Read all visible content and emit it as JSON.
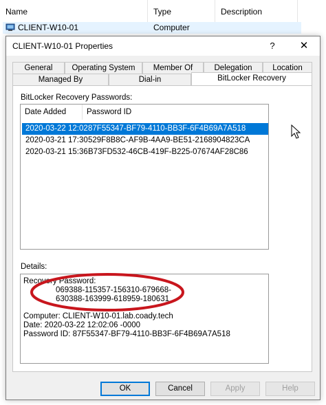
{
  "background_list": {
    "columns": [
      "Name",
      "Type",
      "Description"
    ],
    "row": {
      "name": "CLIENT-W10-01",
      "type": "Computer"
    }
  },
  "dialog": {
    "title": "CLIENT-W10-01 Properties",
    "help": "?",
    "close": "✕",
    "tabs_row1": [
      "General",
      "Operating System",
      "Member Of",
      "Delegation",
      "Location"
    ],
    "tabs_row2": [
      "Managed By",
      "Dial-in",
      "BitLocker Recovery"
    ],
    "active_tab": "BitLocker Recovery",
    "passwords_label": "BitLocker Recovery Passwords:",
    "list_columns": [
      "Date Added",
      "Password ID"
    ],
    "rows": [
      {
        "date": "2020-03-22 12:02",
        "id": "87F55347-BF79-4110-BB3F-6F4B69A7A518"
      },
      {
        "date": "2020-03-21 17:30",
        "id": "529F8B8C-AF9B-4AA9-BE51-2168904823CA"
      },
      {
        "date": "2020-03-21 15:36",
        "id": "B73FD532-46CB-419F-B225-07674AF28C86"
      }
    ],
    "details_label": "Details:",
    "details": {
      "recovery_label": "Recovery Password:",
      "recovery_line1": "069388-115357-156310-679668-",
      "recovery_line2": "630388-163999-618959-180631",
      "computer": "Computer: CLIENT-W10-01.lab.coady.tech",
      "date": "Date: 2020-03-22 12:02:06 -0000",
      "password_id": "Password ID: 87F55347-BF79-4110-BB3F-6F4B69A7A518"
    },
    "buttons": {
      "ok": "OK",
      "cancel": "Cancel",
      "apply": "Apply",
      "help": "Help"
    }
  },
  "colors": {
    "selection": "#0078d7",
    "annotation": "#c8161d"
  }
}
